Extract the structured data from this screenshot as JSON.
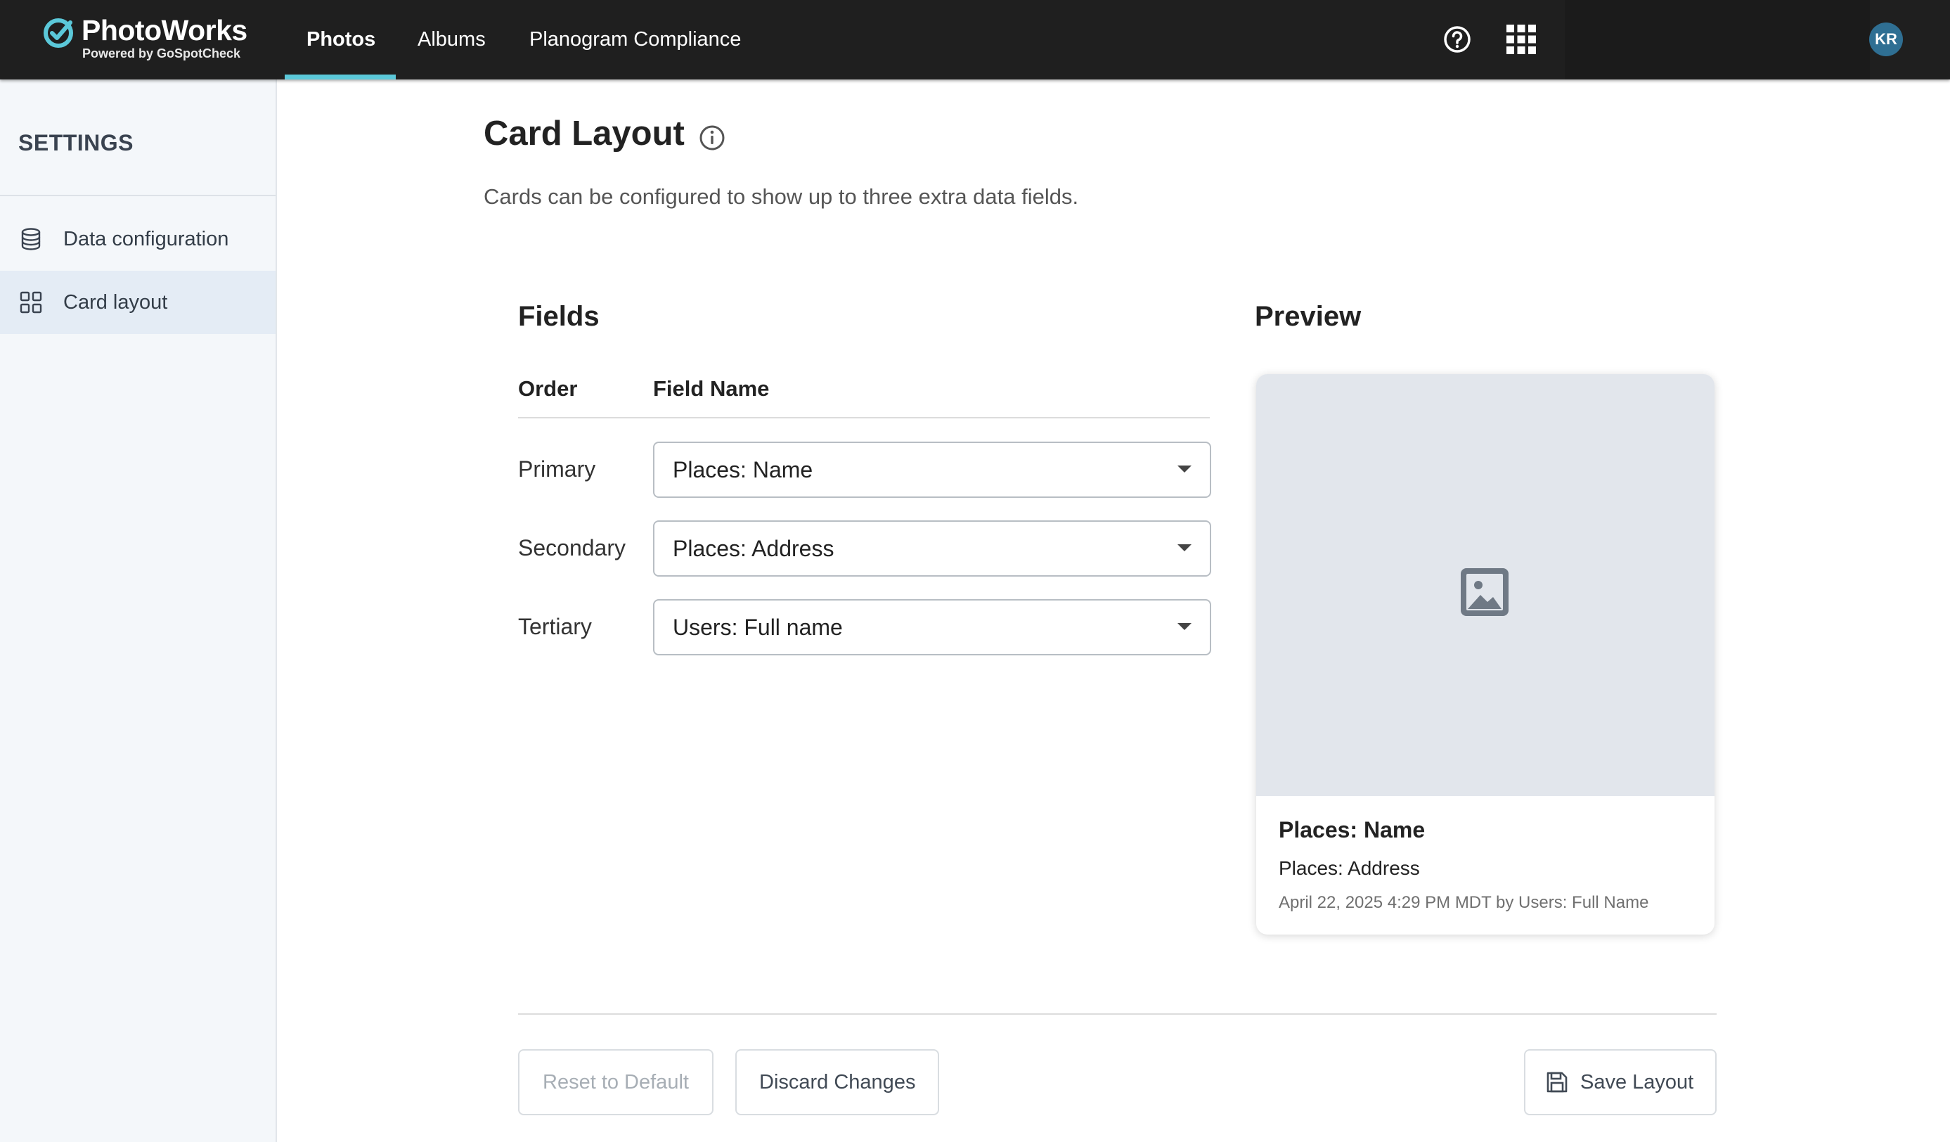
{
  "app": {
    "logo_name": "PhotoWorks",
    "logo_sub": "Powered by GoSpotCheck",
    "accent_color": "#5bc8d9"
  },
  "nav": {
    "items": [
      {
        "label": "Photos",
        "active": true
      },
      {
        "label": "Albums",
        "active": false
      },
      {
        "label": "Planogram Compliance",
        "active": false
      }
    ],
    "help_icon": "help-circle-icon",
    "apps_icon": "grid-apps-icon",
    "user_initials": "KR"
  },
  "sidebar": {
    "title": "SETTINGS",
    "items": [
      {
        "label": "Data configuration",
        "icon": "database-icon",
        "active": false
      },
      {
        "label": "Card layout",
        "icon": "grid-layout-icon",
        "active": true
      }
    ]
  },
  "main": {
    "title": "Card Layout",
    "info_icon": "info-icon",
    "description": "Cards can be configured to show up to three extra data fields.",
    "fields": {
      "title": "Fields",
      "columns": [
        "Order",
        "Field Name"
      ],
      "rows": [
        {
          "order": "Primary",
          "value": "Places: Name"
        },
        {
          "order": "Secondary",
          "value": "Places: Address"
        },
        {
          "order": "Tertiary",
          "value": "Users: Full name"
        }
      ]
    },
    "preview": {
      "title": "Preview",
      "image_icon": "image-placeholder-icon",
      "primary": "Places: Name",
      "secondary": "Places: Address",
      "meta": "April 22, 2025 4:29 PM MDT by Users: Full Name"
    },
    "footer": {
      "reset_label": "Reset to Default",
      "reset_disabled": true,
      "discard_label": "Discard Changes",
      "save_label": "Save Layout",
      "save_icon": "save-icon"
    }
  }
}
